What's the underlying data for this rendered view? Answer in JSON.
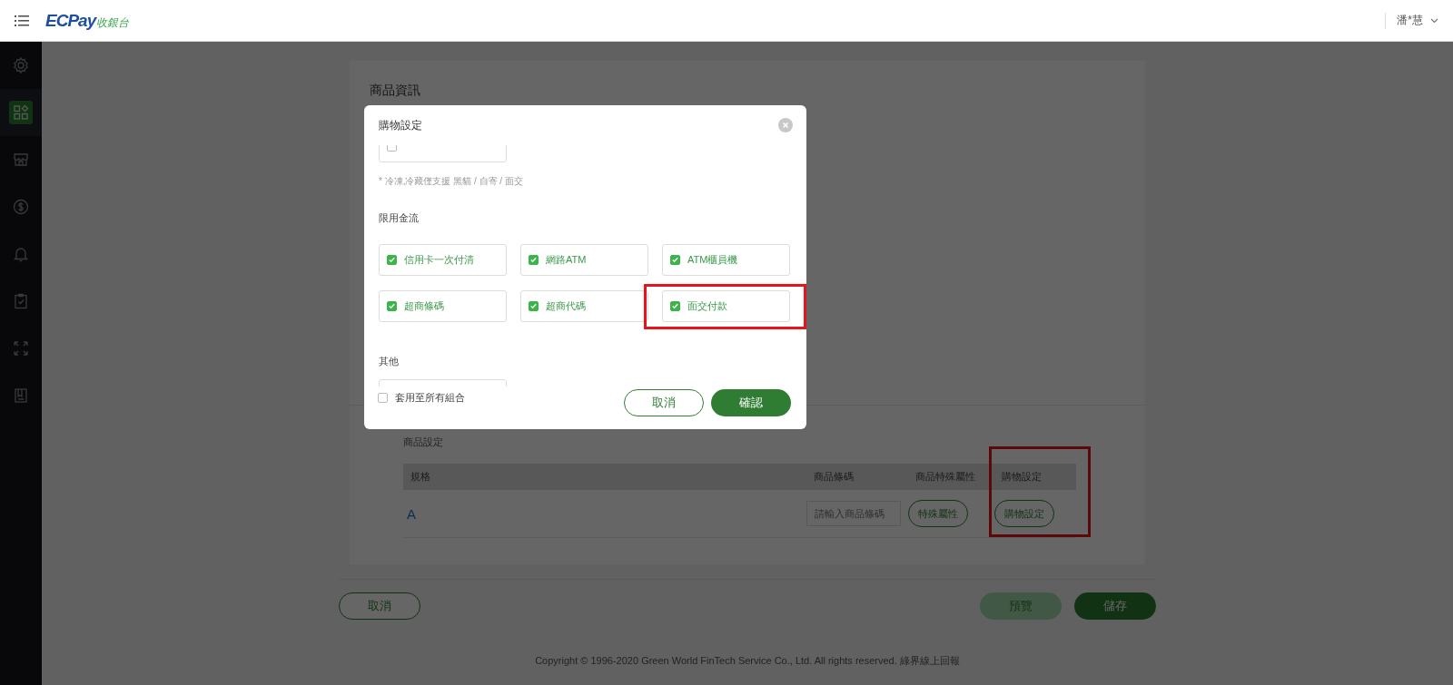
{
  "header": {
    "logo_mark": "ECPay",
    "logo_suffix": "收銀台",
    "user": "潘*慧"
  },
  "sidebar": {
    "items": [
      {
        "selected": false
      },
      {
        "selected": true
      },
      {
        "selected": false
      },
      {
        "selected": false
      },
      {
        "selected": false
      },
      {
        "selected": false
      },
      {
        "selected": false
      },
      {
        "selected": false
      }
    ]
  },
  "card": {
    "title": "商品資訊",
    "section": "商品設定",
    "table": {
      "columns": [
        {
          "label": "規格",
          "highlighted": false
        },
        {
          "label": "商品條碼",
          "highlighted": false
        },
        {
          "label": "商品特殊屬性",
          "highlighted": false
        },
        {
          "label": "購物設定",
          "highlighted": true
        }
      ],
      "rows": [
        {
          "spec": "A",
          "barcode_placeholder": "請輸入商品條碼",
          "attribute_button": "特殊屬性",
          "shopping_button": "購物設定"
        }
      ]
    }
  },
  "actions": {
    "cancel": "取消",
    "preview": "預覽",
    "save": "儲存"
  },
  "footer": "Copyright © 1996-2020 Green World FinTech Service Co., Ltd. All rights reserved. 綠界線上回報",
  "modal": {
    "title": "購物設定",
    "partial_option": {
      "checked": false
    },
    "note": "* 冷凍,冷藏僅支援 黑貓 / 自寄 / 面交",
    "payment_label": "限用金流",
    "payment_options": [
      {
        "label": "信用卡一次付清",
        "checked": true,
        "highlighted": false
      },
      {
        "label": "網路ATM",
        "checked": true,
        "highlighted": false
      },
      {
        "label": "ATM櫃員機",
        "checked": true,
        "highlighted": false
      },
      {
        "label": "超商條碼",
        "checked": true,
        "highlighted": false
      },
      {
        "label": "超商代碼",
        "checked": true,
        "highlighted": false
      },
      {
        "label": "面交付款",
        "checked": true,
        "highlighted": true
      }
    ],
    "other_label": "其他",
    "apply_all": {
      "label": "套用至所有組合",
      "checked": false
    },
    "cancel": "取消",
    "confirm": "確認"
  }
}
